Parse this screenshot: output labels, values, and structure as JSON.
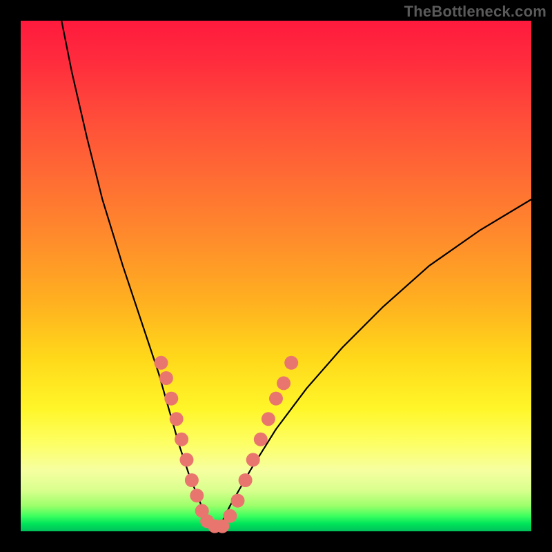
{
  "watermark": "TheBottleneck.com",
  "chart_data": {
    "type": "line",
    "title": "",
    "xlabel": "",
    "ylabel": "",
    "xlim": [
      0,
      100
    ],
    "ylim": [
      0,
      100
    ],
    "grid": false,
    "legend": false,
    "series": [
      {
        "name": "bottleneck-curve",
        "note": "V-shaped curve; minimum ≈ x 37, y 0; steep left branch, shallower right branch",
        "x": [
          8,
          10,
          13,
          16,
          20,
          24,
          27,
          29,
          31,
          33,
          35,
          37,
          39,
          41,
          45,
          50,
          56,
          63,
          71,
          80,
          90,
          100
        ],
        "y": [
          100,
          90,
          77,
          65,
          52,
          40,
          31,
          24,
          17,
          11,
          6,
          1,
          1,
          5,
          12,
          20,
          28,
          36,
          44,
          52,
          59,
          65
        ]
      }
    ],
    "markers": {
      "name": "data-points",
      "note": "salmon dots clustered near the valley along both branches",
      "color": "#e9766e",
      "radius_px": 10,
      "points": [
        {
          "x": 27.5,
          "y": 33
        },
        {
          "x": 28.5,
          "y": 30
        },
        {
          "x": 29.5,
          "y": 26
        },
        {
          "x": 30.5,
          "y": 22
        },
        {
          "x": 31.5,
          "y": 18
        },
        {
          "x": 32.5,
          "y": 14
        },
        {
          "x": 33.5,
          "y": 10
        },
        {
          "x": 34.5,
          "y": 7
        },
        {
          "x": 35.5,
          "y": 4
        },
        {
          "x": 36.5,
          "y": 2
        },
        {
          "x": 38.0,
          "y": 1
        },
        {
          "x": 39.5,
          "y": 1
        },
        {
          "x": 41.0,
          "y": 3
        },
        {
          "x": 42.5,
          "y": 6
        },
        {
          "x": 44.0,
          "y": 10
        },
        {
          "x": 45.5,
          "y": 14
        },
        {
          "x": 47.0,
          "y": 18
        },
        {
          "x": 48.5,
          "y": 22
        },
        {
          "x": 50.0,
          "y": 26
        },
        {
          "x": 51.5,
          "y": 29
        },
        {
          "x": 53.0,
          "y": 33
        }
      ]
    }
  }
}
